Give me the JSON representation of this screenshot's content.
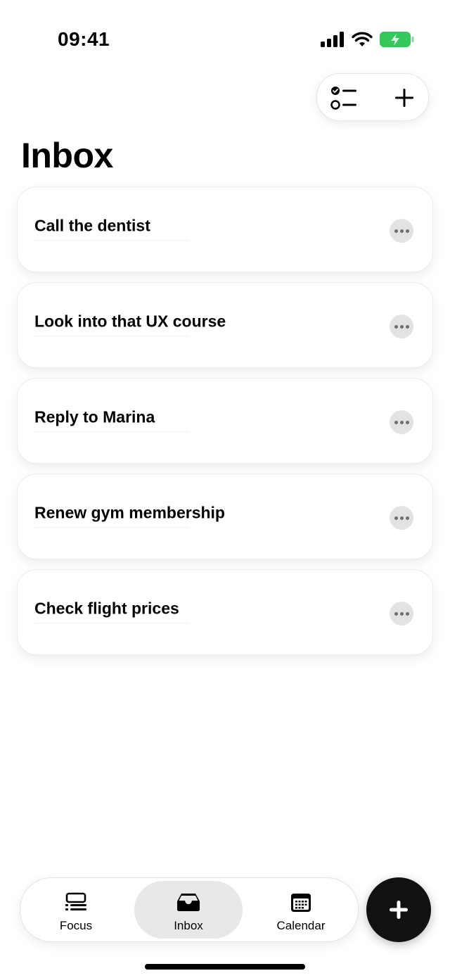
{
  "status_bar": {
    "time": "09:41"
  },
  "page": {
    "title": "Inbox"
  },
  "tasks": [
    {
      "title": "Call the dentist"
    },
    {
      "title": "Look into that UX course"
    },
    {
      "title": "Reply to Marina"
    },
    {
      "title": "Renew gym membership"
    },
    {
      "title": "Check flight prices"
    }
  ],
  "tab_bar": {
    "tabs": [
      {
        "label": "Focus",
        "icon": "focus-icon"
      },
      {
        "label": "Inbox",
        "icon": "inbox-tray-icon",
        "selected": true
      },
      {
        "label": "Calendar",
        "icon": "calendar-icon"
      }
    ]
  },
  "colors": {
    "battery": "#34c759",
    "fab": "#111111",
    "selected_tab": "#e8e8e8"
  }
}
